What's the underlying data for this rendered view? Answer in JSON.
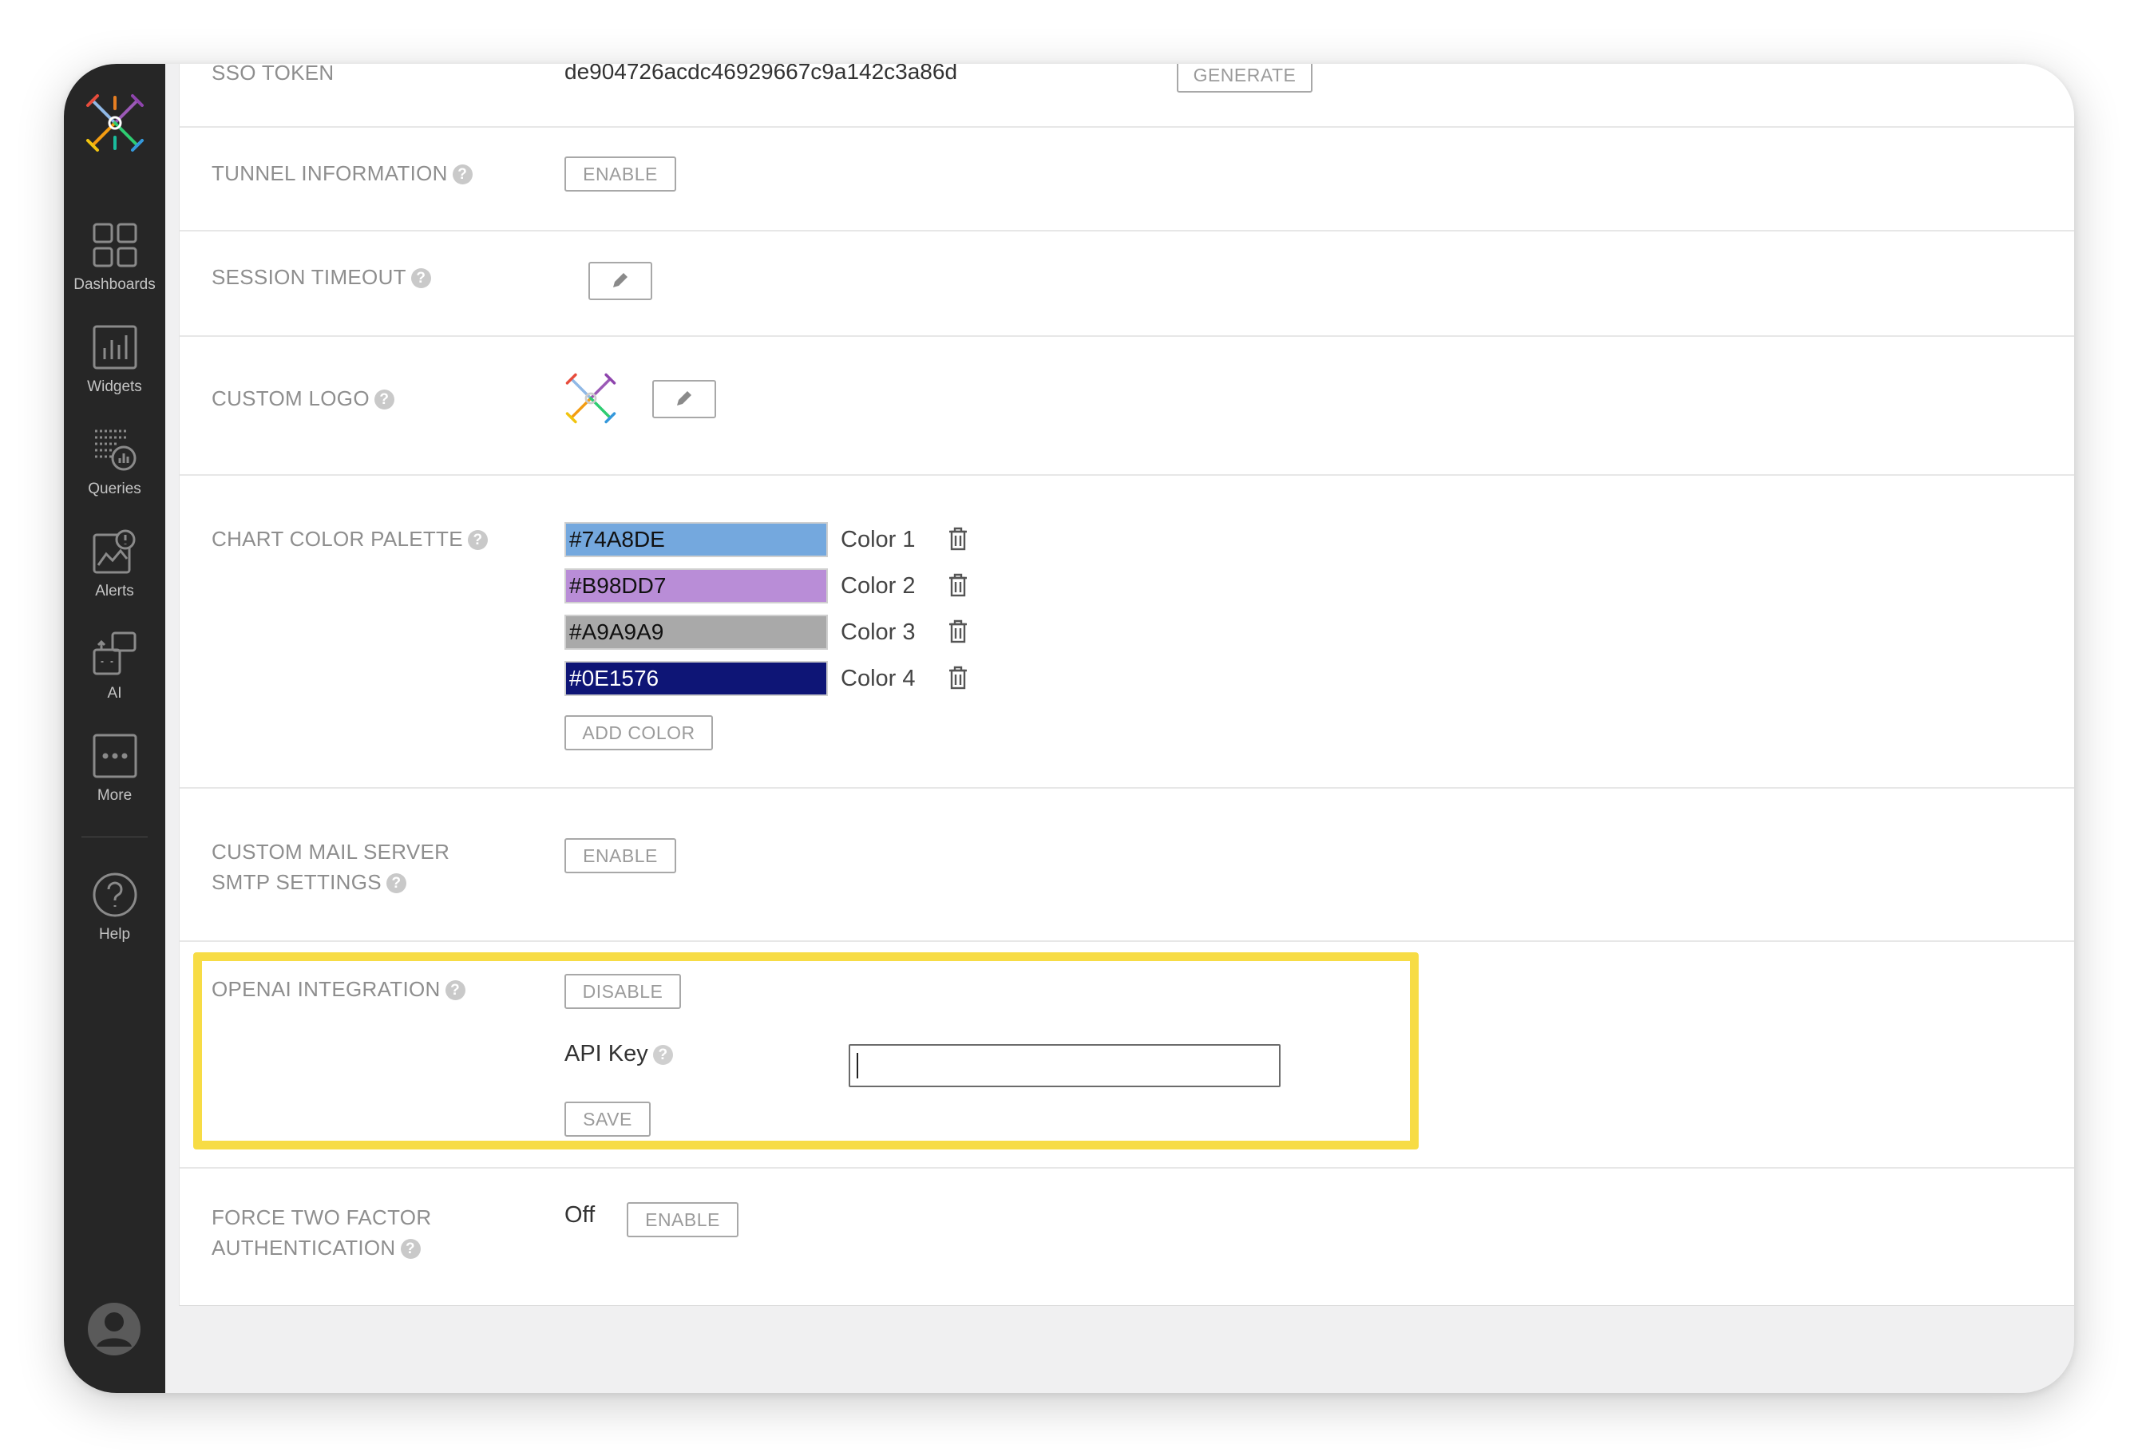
{
  "sidebar": {
    "items": [
      {
        "label": "Dashboards",
        "icon": "dashboards-icon"
      },
      {
        "label": "Widgets",
        "icon": "widgets-icon"
      },
      {
        "label": "Queries",
        "icon": "queries-icon"
      },
      {
        "label": "Alerts",
        "icon": "alerts-icon"
      },
      {
        "label": "AI",
        "icon": "ai-icon"
      },
      {
        "label": "More",
        "icon": "more-icon"
      }
    ],
    "help_label": "Help"
  },
  "settings": {
    "sso": {
      "label": "SSO TOKEN",
      "value": "de904726acdc46929667c9a142c3a86d",
      "button": "GENERATE"
    },
    "tunnel": {
      "label": "TUNNEL INFORMATION",
      "button": "ENABLE"
    },
    "session": {
      "label": "SESSION TIMEOUT"
    },
    "logo": {
      "label": "CUSTOM LOGO"
    },
    "palette": {
      "label": "CHART COLOR PALETTE",
      "colors": [
        {
          "hex": "#74A8DE",
          "name": "Color 1"
        },
        {
          "hex": "#B98DD7",
          "name": "Color 2"
        },
        {
          "hex": "#A9A9A9",
          "name": "Color 3"
        },
        {
          "hex": "#0E1576",
          "name": "Color 4"
        }
      ],
      "add_button": "ADD COLOR"
    },
    "mail": {
      "label_line1": "CUSTOM MAIL SERVER",
      "label_line2": "SMTP SETTINGS",
      "button": "ENABLE"
    },
    "openai": {
      "label": "OPENAI INTEGRATION",
      "button": "DISABLE",
      "api_key_label": "API Key",
      "api_key_value": "",
      "save_button": "SAVE"
    },
    "two_factor": {
      "label_line1": "FORCE TWO FACTOR",
      "label_line2": "AUTHENTICATION",
      "status": "Off",
      "button": "ENABLE"
    }
  },
  "colors": {
    "sidebar_bg": "#262626",
    "highlight": "#f7dc45"
  }
}
